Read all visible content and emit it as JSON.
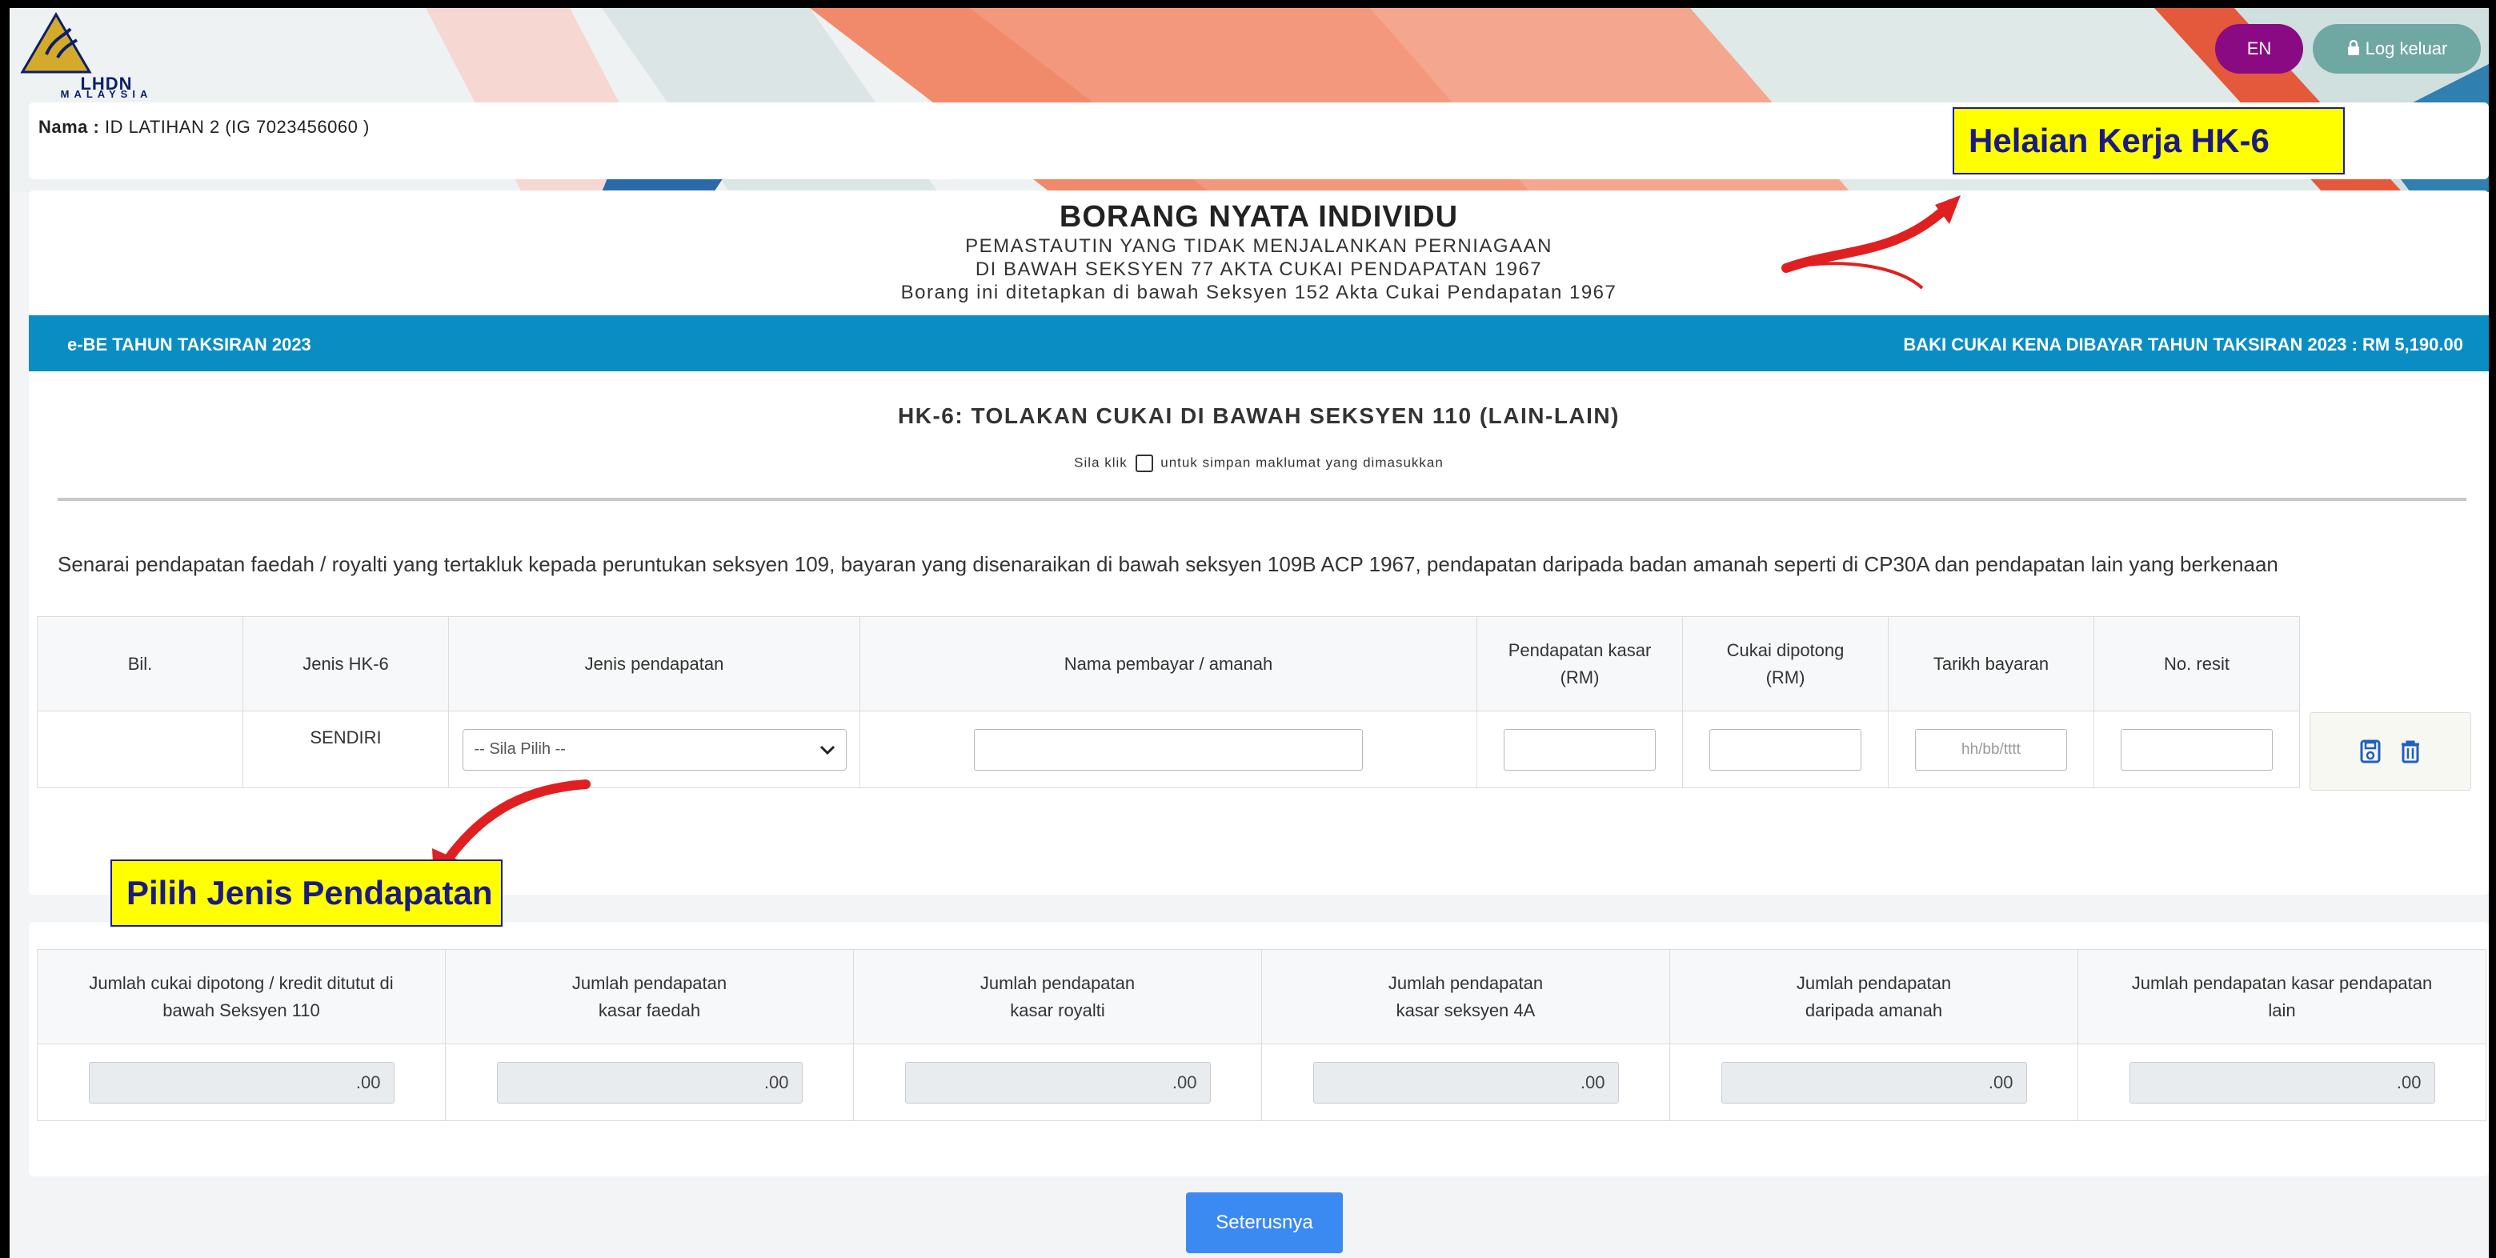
{
  "header": {
    "logo_text": "LHDN",
    "logo_sub": "MALAYSIA",
    "lang_button": "EN",
    "logout_button": "Log keluar"
  },
  "user": {
    "name_label": "Nama :",
    "name_value": "ID LATIHAN 2 (IG 7023456060 )"
  },
  "callouts": {
    "worksheet": "Helaian Kerja HK-6",
    "select_income": "Pilih Jenis Pendapatan"
  },
  "form": {
    "title": "BORANG NYATA INDIVIDU",
    "subtitle_1": "PEMASTAUTIN YANG TIDAK MENJALANKAN PERNIAGAAN",
    "subtitle_2": "DI BAWAH SEKSYEN 77 AKTA CUKAI PENDAPATAN 1967",
    "subtitle_3": "Borang ini ditetapkan di bawah Seksyen 152 Akta Cukai Pendapatan 1967"
  },
  "bar": {
    "left": "e-BE TAHUN TAKSIRAN 2023",
    "right": "BAKI CUKAI KENA DIBAYAR TAHUN TAKSIRAN 2023 : RM 5,190.00"
  },
  "hk6": {
    "title": "HK-6: TOLAKAN CUKAI DI BAWAH SEKSYEN 110 (LAIN-LAIN)",
    "hint_before": "Sila klik",
    "hint_after": "untuk simpan maklumat yang dimasukkan",
    "description": "Senarai pendapatan faedah / royalti yang tertakluk kepada peruntukan seksyen 109, bayaran yang disenaraikan di bawah seksyen 109B ACP 1967, pendapatan daripada badan amanah seperti di CP30A dan pendapatan lain yang berkenaan"
  },
  "table": {
    "headers": [
      "Bil.",
      "Jenis HK-6",
      "Jenis pendapatan",
      "Nama pembayar / amanah",
      "Pendapatan kasar (RM)",
      "Cukai dipotong (RM)",
      "Tarikh bayaran",
      "No. resit"
    ],
    "row": {
      "jenis_hk6": "SENDIRI",
      "select_value": "-- Sila Pilih --",
      "date_placeholder": "hh/bb/tttt"
    }
  },
  "totals": {
    "headers": [
      "Jumlah cukai dipotong / kredit ditutut di bawah Seksyen 110",
      "Jumlah pendapatan kasar faedah",
      "Jumlah pendapatan kasar royalti",
      "Jumlah pendapatan kasar seksyen 4A",
      "Jumlah pendapatan daripada amanah",
      "Jumlah pendapatan kasar pendapatan lain"
    ],
    "values": [
      ".00",
      ".00",
      ".00",
      ".00",
      ".00",
      ".00"
    ]
  },
  "next_button": "Seterusnya",
  "colors": {
    "bar": "#0a8dc2",
    "lang_button": "#8a0a83",
    "logout_button": "#6fa8a3",
    "next_button": "#3b8af2",
    "callout": "#ffff00"
  }
}
